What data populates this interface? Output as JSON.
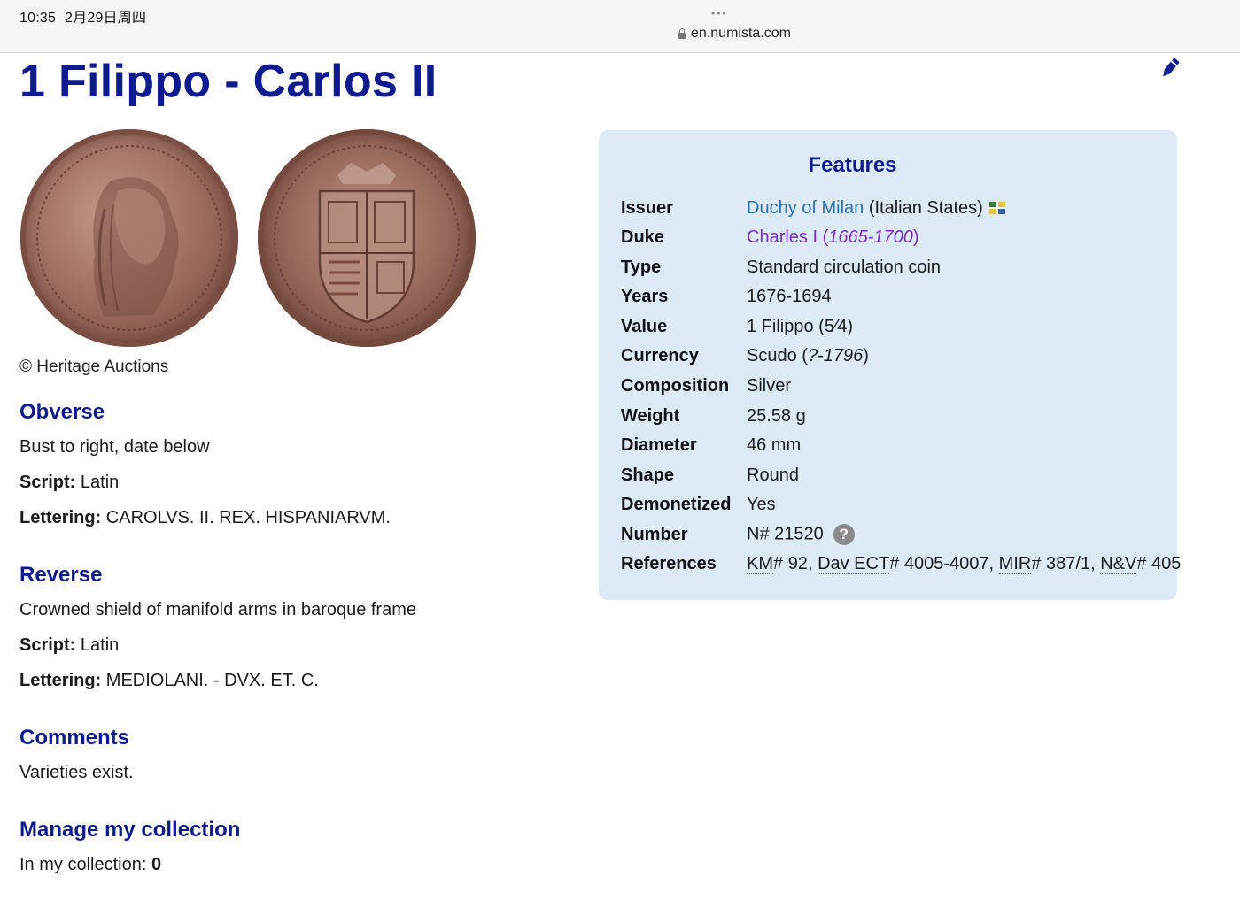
{
  "status_bar": {
    "time": "10:35",
    "date": "2月29日周四"
  },
  "browser": {
    "url": "en.numista.com",
    "tab_indicator": "•••"
  },
  "page": {
    "title": "1 Filippo - Carlos II",
    "photo_credit": "© Heritage Auctions",
    "obverse": {
      "heading": "Obverse",
      "description": "Bust to right, date below",
      "script_label": "Script:",
      "script": "Latin",
      "lettering_label": "Lettering:",
      "lettering": "CAROLVS. II. REX. HISPANIARVM."
    },
    "reverse": {
      "heading": "Reverse",
      "description": "Crowned shield of manifold arms in baroque frame",
      "script_label": "Script:",
      "script": "Latin",
      "lettering_label": "Lettering:",
      "lettering": "MEDIOLANI. - DVX. ET. C."
    },
    "comments": {
      "heading": "Comments",
      "text": "Varieties exist."
    },
    "collection": {
      "heading": "Manage my collection",
      "label": "In my collection:",
      "count": "0"
    }
  },
  "features": {
    "title": "Features",
    "issuer": {
      "label": "Issuer",
      "link": "Duchy of Milan",
      "suffix": "(Italian States)"
    },
    "duke": {
      "label": "Duke",
      "name": "Charles I",
      "years": "1665-1700"
    },
    "type": {
      "label": "Type",
      "value": "Standard circulation coin"
    },
    "years": {
      "label": "Years",
      "value": "1676-1694"
    },
    "value": {
      "label": "Value",
      "value": "1 Filippo (5⁄4)"
    },
    "currency": {
      "label": "Currency",
      "name": "Scudo",
      "period": "?-1796"
    },
    "composition": {
      "label": "Composition",
      "value": "Silver"
    },
    "weight": {
      "label": "Weight",
      "value": "25.58 g"
    },
    "diameter": {
      "label": "Diameter",
      "value": "46 mm"
    },
    "shape": {
      "label": "Shape",
      "value": "Round"
    },
    "demonetized": {
      "label": "Demonetized",
      "value": "Yes"
    },
    "number": {
      "label": "Number",
      "value": "N# 21520",
      "help": "?"
    },
    "references": {
      "label": "References",
      "items": [
        {
          "cat": "KM",
          "num": "92"
        },
        {
          "cat": "Dav ECT",
          "num": "4005-4007"
        },
        {
          "cat": "MIR",
          "num": "387/1"
        },
        {
          "cat": "N&V",
          "num": "405"
        }
      ]
    }
  },
  "icons": {
    "edit": "pencil-edit-icon",
    "lock": "lock-icon",
    "flag": "flag-icon",
    "help": "help-icon"
  },
  "colors": {
    "heading": "#0d1b8c",
    "link_blue": "#2a6fb0",
    "link_purple": "#7a2bbf",
    "features_bg": "#dcebf7"
  }
}
